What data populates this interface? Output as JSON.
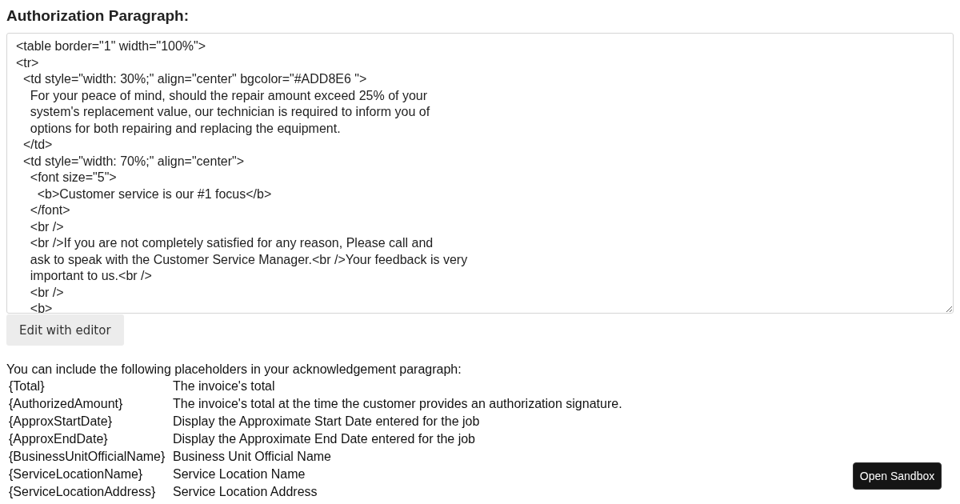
{
  "heading": "Authorization Paragraph:",
  "editor": {
    "lines": [
      "<table border=\"1\" width=\"100%\">",
      "<tr>",
      "  <td style=\"width: 30%;\" align=\"center\" bgcolor=\"#ADD8E6 \">",
      "    For your peace of mind, should the repair amount exceed 25% of your",
      "    system's replacement value, our technician is required to inform you of",
      "    options for both repairing and replacing the equipment.",
      "  </td>",
      "  <td style=\"width: 70%;\" align=\"center\">",
      "    <font size=\"5\">",
      "      <b>Customer service is our #1 focus</b>",
      "    </font>",
      "    <br />",
      "    <br />If you are not completely satisfied for any reason, Please call and",
      "    ask to speak with the Customer Service Manager.<br />Your feedback is very",
      "    important to us.<br />",
      "    <br />",
      "    <b>"
    ]
  },
  "edit_button": "Edit with editor",
  "placeholders_intro": "You can include the following placeholders in your acknowledgement paragraph:",
  "placeholders": [
    {
      "token": "{Total}",
      "description": "The invoice's total"
    },
    {
      "token": "{AuthorizedAmount}",
      "description": "The invoice's total at the time the customer provides an authorization signature."
    },
    {
      "token": "{ApproxStartDate}",
      "description": "Display the Approximate Start Date entered for the job"
    },
    {
      "token": "{ApproxEndDate}",
      "description": "Display the Approximate End Date entered for the job"
    },
    {
      "token": "{BusinessUnitOfficialName}",
      "description": "Business Unit Official Name"
    },
    {
      "token": "{ServiceLocationName}",
      "description": "Service Location Name"
    },
    {
      "token": "{ServiceLocationAddress}",
      "description": "Service Location Address"
    }
  ],
  "sandbox_button": "Open Sandbox"
}
